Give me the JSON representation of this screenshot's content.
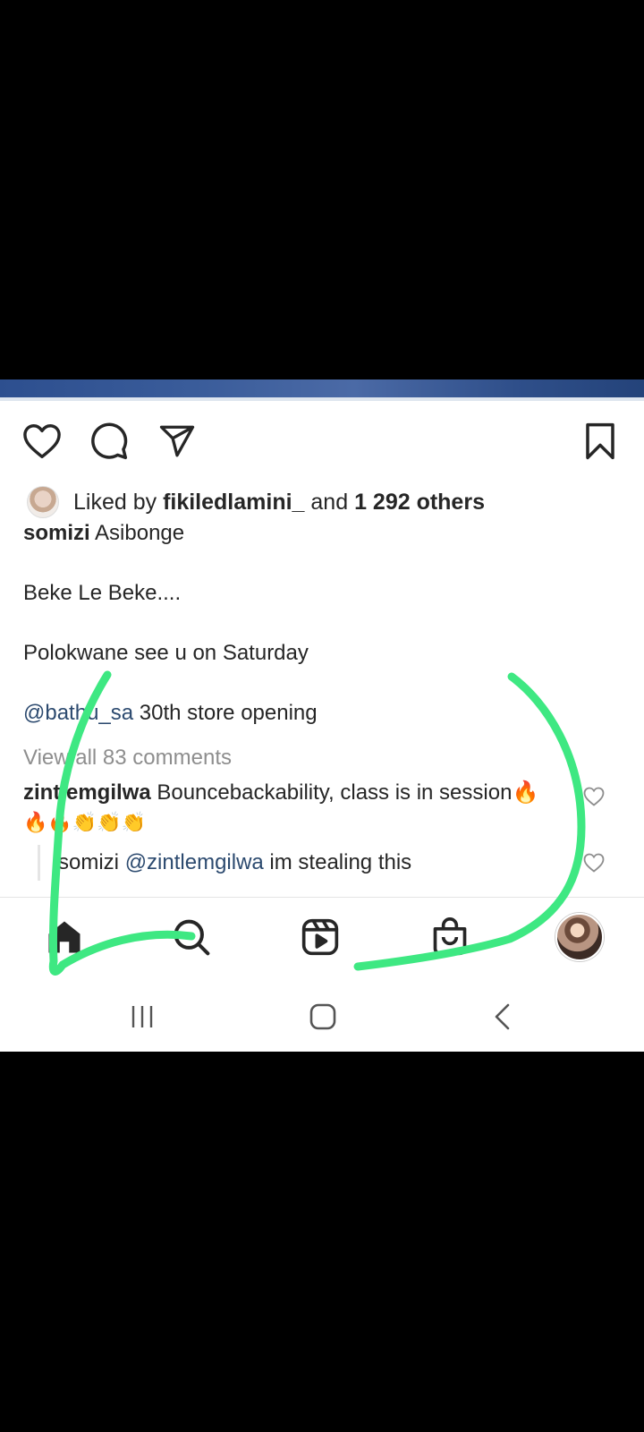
{
  "post": {
    "likes": {
      "prefix": "Liked by ",
      "user": "fikiledlamini_",
      "middle": " and ",
      "others": "1 292 others"
    },
    "caption": {
      "author": "somizi",
      "line1": " Asibonge",
      "line2": "Beke Le Beke....",
      "line3": "Polokwane see u on Saturday",
      "mention": "@bathu_sa",
      "line4_rest": "  30th store opening"
    },
    "view_comments": "View all 83 comments",
    "comments": [
      {
        "author": "zintlemgilwa",
        "text": " Bouncebackability, class is in session",
        "emoji": "🔥",
        "emoji_row": "🔥🔥👏👏👏"
      }
    ],
    "reply": {
      "author": "somizi",
      "mention": "@zintlemgilwa",
      "text": " im stealing this"
    }
  },
  "icons": {
    "action_bar": [
      "heart-icon",
      "comment-icon",
      "share-icon",
      "bookmark-icon"
    ],
    "bottom_nav": [
      "home-icon",
      "search-icon",
      "reels-icon",
      "shop-icon",
      "profile-avatar"
    ],
    "system_nav": [
      "recents-icon",
      "home-circle-icon",
      "back-icon"
    ]
  },
  "colors": {
    "scribble": "#3ee882",
    "mention": "#2c4a6f",
    "muted": "#8e8e8e"
  }
}
